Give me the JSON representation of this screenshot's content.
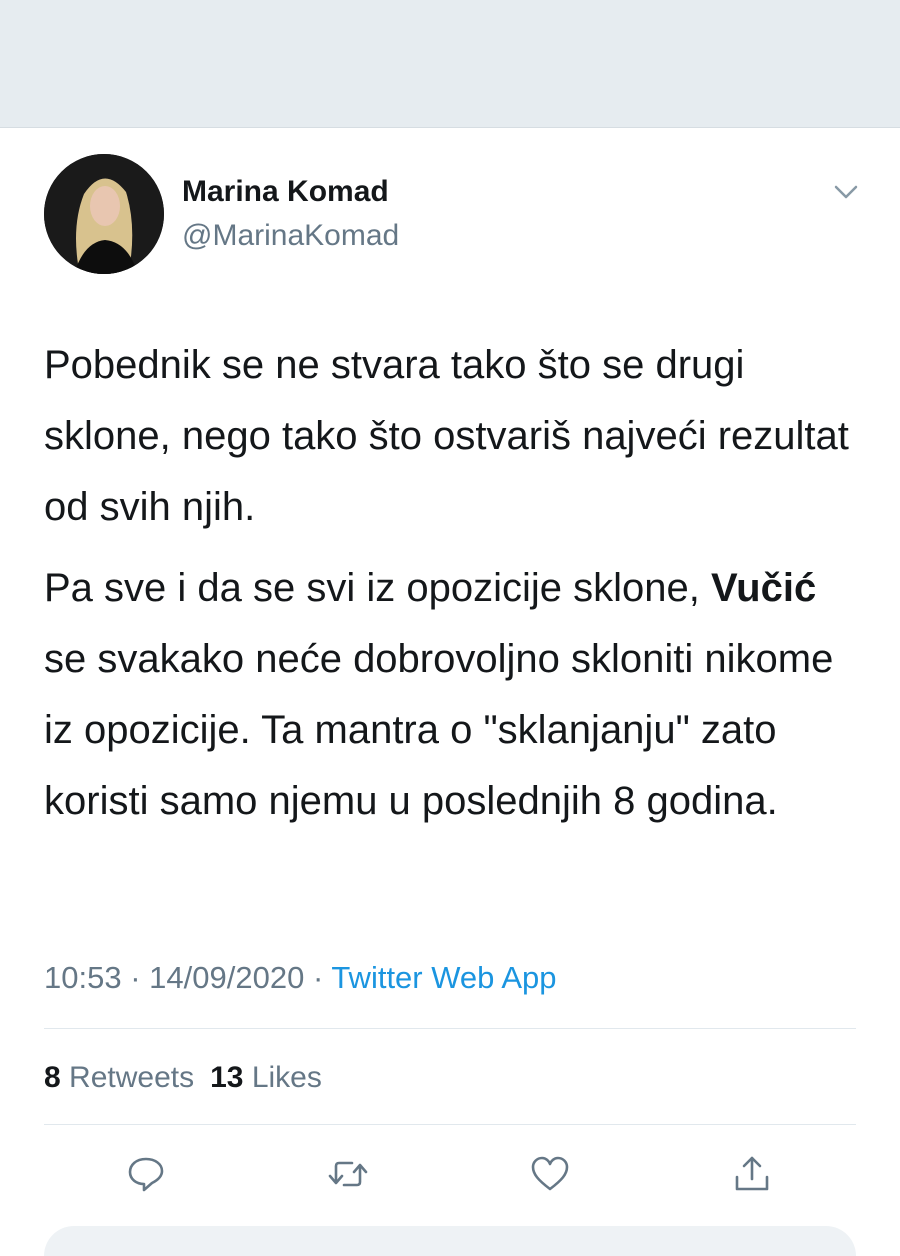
{
  "user": {
    "display_name": "Marina Komad",
    "handle": "@MarinaKomad"
  },
  "tweet": {
    "paragraph1": "Pobednik se ne stvara tako što se drugi sklone, nego tako što ostvariš najveći rezultat od svih njih.",
    "paragraph2_prefix": "Pa sve i da se svi iz opozicije sklone,",
    "paragraph2_bold": "Vučić",
    "paragraph2_suffix": "se svakako neće dobrovoljno skloniti nikome iz opozicije. Ta mantra o \"sklanjanju\" zato koristi samo njemu u poslednjih 8 godina."
  },
  "meta": {
    "time": "10:53",
    "separator": "·",
    "date": "14/09/2020",
    "source": "Twitter Web App"
  },
  "stats": {
    "retweets_count": "8",
    "retweets_label": "Retweets",
    "likes_count": "13",
    "likes_label": "Likes"
  },
  "actions": {
    "reply_icon": "reply-icon",
    "retweet_icon": "retweet-icon",
    "like_icon": "heart-icon",
    "share_icon": "share-icon"
  },
  "colors": {
    "link": "#1b95e0",
    "secondary_text": "#657786",
    "primary_text": "#14171a",
    "icon": "#657786"
  }
}
